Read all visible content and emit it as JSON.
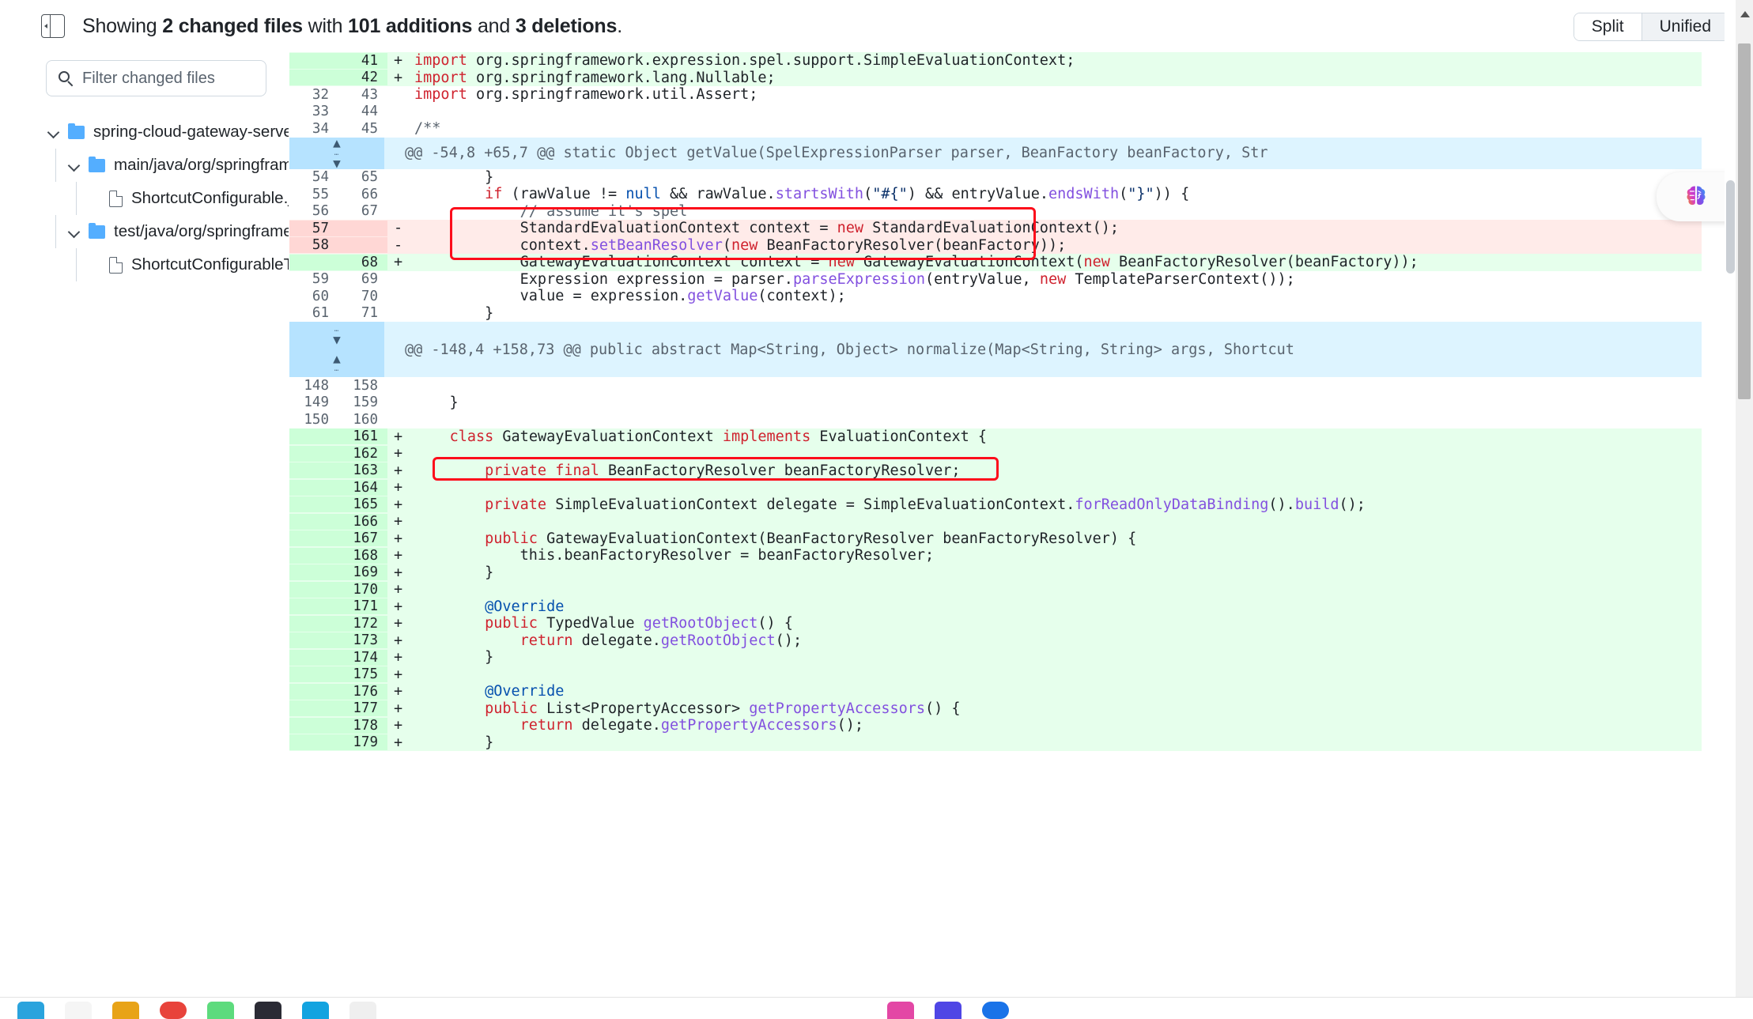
{
  "header": {
    "toggle_sidebar_icon": "sidebar-collapse-icon",
    "summary_prefix": "Showing ",
    "summary_files": "2 changed files",
    "summary_mid": " with ",
    "summary_additions": "101 additions",
    "summary_and": " and ",
    "summary_deletions": "3 deletions",
    "summary_suffix": ".",
    "view_split": "Split",
    "view_unified": "Unified",
    "active_view": "Unified"
  },
  "sidebar": {
    "filter_placeholder": "Filter changed files",
    "search_icon": "search-icon",
    "tree": [
      {
        "kind": "folder",
        "label": "spring-cloud-gateway-server/src",
        "depth": 0,
        "expanded": true
      },
      {
        "kind": "folder",
        "label": "main/java/org/springframework...",
        "depth": 1,
        "expanded": true
      },
      {
        "kind": "file",
        "label": "ShortcutConfigurable.java",
        "depth": 2,
        "status": "modified"
      },
      {
        "kind": "folder",
        "label": "test/java/org/springframework/...",
        "depth": 1,
        "expanded": true
      },
      {
        "kind": "file",
        "label": "ShortcutConfigurableTests....",
        "depth": 2,
        "status": "modified"
      }
    ]
  },
  "colors": {
    "addition_bg": "#e6ffec",
    "addition_gutter": "#ccffd8",
    "deletion_bg": "#ffebe9",
    "deletion_gutter": "#ffd7d5",
    "hunk_bg": "#ddf4ff",
    "hunk_gutter": "#b6e3ff",
    "annotation_box": "#fc0d1b",
    "folder_icon": "#54aeff",
    "status_modified": "#9a6700"
  },
  "diff": {
    "rows": [
      {
        "type": "add",
        "old": "",
        "new": "41",
        "sign": "+",
        "parts": [
          {
            "t": "import ",
            "c": "kw"
          },
          {
            "t": "org.springframework.expression.spel.support.SimpleEvaluationContext;",
            "c": ""
          }
        ]
      },
      {
        "type": "add",
        "old": "",
        "new": "42",
        "sign": "+",
        "parts": [
          {
            "t": "import ",
            "c": "kw"
          },
          {
            "t": "org.springframework.lang.Nullable;",
            "c": ""
          }
        ]
      },
      {
        "type": "ctx",
        "old": "32",
        "new": "43",
        "sign": "",
        "parts": [
          {
            "t": "import ",
            "c": "kw"
          },
          {
            "t": "org.springframework.util.Assert;",
            "c": ""
          }
        ]
      },
      {
        "type": "ctx",
        "old": "33",
        "new": "44",
        "sign": "",
        "parts": [
          {
            "t": "",
            "c": ""
          }
        ]
      },
      {
        "type": "ctx",
        "old": "34",
        "new": "45",
        "sign": "",
        "parts": [
          {
            "t": "/**",
            "c": "cmt"
          }
        ]
      },
      {
        "type": "hunk",
        "expand": "both",
        "height": 40,
        "text": "@@ -54,8 +65,7 @@ static Object getValue(SpelExpressionParser parser, BeanFactory beanFactory, Str"
      },
      {
        "type": "ctx",
        "old": "54",
        "new": "65",
        "sign": "",
        "parts": [
          {
            "t": "        }",
            "c": ""
          }
        ]
      },
      {
        "type": "ctx",
        "old": "55",
        "new": "66",
        "sign": "",
        "parts": [
          {
            "t": "        ",
            "c": ""
          },
          {
            "t": "if",
            "c": "kw"
          },
          {
            "t": " (rawValue != ",
            "c": ""
          },
          {
            "t": "null",
            "c": "num"
          },
          {
            "t": " && rawValue.",
            "c": ""
          },
          {
            "t": "startsWith",
            "c": "fn"
          },
          {
            "t": "(",
            "c": ""
          },
          {
            "t": "\"#{\"",
            "c": "str"
          },
          {
            "t": ") && entryValue.",
            "c": ""
          },
          {
            "t": "endsWith",
            "c": "fn"
          },
          {
            "t": "(",
            "c": ""
          },
          {
            "t": "\"}\"",
            "c": "str"
          },
          {
            "t": ")) {",
            "c": ""
          }
        ]
      },
      {
        "type": "ctx",
        "old": "56",
        "new": "67",
        "sign": "",
        "parts": [
          {
            "t": "            // assume it's spel",
            "c": "cmt"
          }
        ]
      },
      {
        "type": "del",
        "old": "57",
        "new": "",
        "sign": "-",
        "parts": [
          {
            "t": "            StandardEvaluationContext context = ",
            "c": ""
          },
          {
            "t": "new",
            "c": "kw"
          },
          {
            "t": " StandardEvaluationContext();",
            "c": ""
          }
        ]
      },
      {
        "type": "del",
        "old": "58",
        "new": "",
        "sign": "-",
        "parts": [
          {
            "t": "            context.",
            "c": ""
          },
          {
            "t": "setBeanResolver",
            "c": "fn"
          },
          {
            "t": "(",
            "c": ""
          },
          {
            "t": "new",
            "c": "kw"
          },
          {
            "t": " BeanFactoryResolver(beanFactory));",
            "c": ""
          }
        ]
      },
      {
        "type": "add",
        "old": "",
        "new": "68",
        "sign": "+",
        "parts": [
          {
            "t": "            GatewayEvaluationContext context = ",
            "c": ""
          },
          {
            "t": "new",
            "c": "kw"
          },
          {
            "t": " GatewayEvaluationContext(",
            "c": ""
          },
          {
            "t": "new",
            "c": "kw"
          },
          {
            "t": " BeanFactoryResolver(beanFactory));",
            "c": ""
          }
        ]
      },
      {
        "type": "ctx",
        "old": "59",
        "new": "69",
        "sign": "",
        "parts": [
          {
            "t": "            Expression expression = parser.",
            "c": ""
          },
          {
            "t": "parseExpression",
            "c": "fn"
          },
          {
            "t": "(entryValue, ",
            "c": ""
          },
          {
            "t": "new",
            "c": "kw"
          },
          {
            "t": " TemplateParserContext());",
            "c": ""
          }
        ]
      },
      {
        "type": "ctx",
        "old": "60",
        "new": "70",
        "sign": "",
        "parts": [
          {
            "t": "            value = expression.",
            "c": ""
          },
          {
            "t": "getValue",
            "c": "fn"
          },
          {
            "t": "(context);",
            "c": ""
          }
        ]
      },
      {
        "type": "ctx",
        "old": "61",
        "new": "71",
        "sign": "",
        "parts": [
          {
            "t": "        }",
            "c": ""
          }
        ]
      },
      {
        "type": "hunk",
        "expand": "updown",
        "height": 70,
        "text": "@@ -148,4 +158,73 @@ public abstract Map<String, Object> normalize(Map<String, String> args, Shortcut"
      },
      {
        "type": "ctx",
        "old": "148",
        "new": "158",
        "sign": "",
        "parts": [
          {
            "t": "",
            "c": ""
          }
        ]
      },
      {
        "type": "ctx",
        "old": "149",
        "new": "159",
        "sign": "",
        "parts": [
          {
            "t": "    }",
            "c": ""
          }
        ]
      },
      {
        "type": "ctx",
        "old": "150",
        "new": "160",
        "sign": "",
        "parts": [
          {
            "t": "",
            "c": ""
          }
        ]
      },
      {
        "type": "add",
        "old": "",
        "new": "161",
        "sign": "+",
        "parts": [
          {
            "t": "    ",
            "c": ""
          },
          {
            "t": "class",
            "c": "kw"
          },
          {
            "t": " GatewayEvaluationContext ",
            "c": ""
          },
          {
            "t": "implements",
            "c": "kw"
          },
          {
            "t": " EvaluationContext {",
            "c": ""
          }
        ]
      },
      {
        "type": "add",
        "old": "",
        "new": "162",
        "sign": "+",
        "parts": [
          {
            "t": "",
            "c": ""
          }
        ]
      },
      {
        "type": "add",
        "old": "",
        "new": "163",
        "sign": "+",
        "parts": [
          {
            "t": "        ",
            "c": ""
          },
          {
            "t": "private final",
            "c": "kw"
          },
          {
            "t": " BeanFactoryResolver beanFactoryResolver;",
            "c": ""
          }
        ]
      },
      {
        "type": "add",
        "old": "",
        "new": "164",
        "sign": "+",
        "parts": [
          {
            "t": "",
            "c": ""
          }
        ]
      },
      {
        "type": "add",
        "old": "",
        "new": "165",
        "sign": "+",
        "parts": [
          {
            "t": "        ",
            "c": ""
          },
          {
            "t": "private",
            "c": "kw"
          },
          {
            "t": " SimpleEvaluationContext delegate = SimpleEvaluationContext.",
            "c": ""
          },
          {
            "t": "forReadOnlyDataBinding",
            "c": "fn"
          },
          {
            "t": "().",
            "c": ""
          },
          {
            "t": "build",
            "c": "fn"
          },
          {
            "t": "();",
            "c": ""
          }
        ]
      },
      {
        "type": "add",
        "old": "",
        "new": "166",
        "sign": "+",
        "parts": [
          {
            "t": "",
            "c": ""
          }
        ]
      },
      {
        "type": "add",
        "old": "",
        "new": "167",
        "sign": "+",
        "parts": [
          {
            "t": "        ",
            "c": ""
          },
          {
            "t": "public",
            "c": "kw"
          },
          {
            "t": " GatewayEvaluationContext(BeanFactoryResolver beanFactoryResolver) {",
            "c": ""
          }
        ]
      },
      {
        "type": "add",
        "old": "",
        "new": "168",
        "sign": "+",
        "parts": [
          {
            "t": "            this.beanFactoryResolver = beanFactoryResolver;",
            "c": ""
          }
        ]
      },
      {
        "type": "add",
        "old": "",
        "new": "169",
        "sign": "+",
        "parts": [
          {
            "t": "        }",
            "c": ""
          }
        ]
      },
      {
        "type": "add",
        "old": "",
        "new": "170",
        "sign": "+",
        "parts": [
          {
            "t": "",
            "c": ""
          }
        ]
      },
      {
        "type": "add",
        "old": "",
        "new": "171",
        "sign": "+",
        "parts": [
          {
            "t": "        ",
            "c": ""
          },
          {
            "t": "@Override",
            "c": "ann"
          }
        ]
      },
      {
        "type": "add",
        "old": "",
        "new": "172",
        "sign": "+",
        "parts": [
          {
            "t": "        ",
            "c": ""
          },
          {
            "t": "public",
            "c": "kw"
          },
          {
            "t": " TypedValue ",
            "c": ""
          },
          {
            "t": "getRootObject",
            "c": "fn"
          },
          {
            "t": "() {",
            "c": ""
          }
        ]
      },
      {
        "type": "add",
        "old": "",
        "new": "173",
        "sign": "+",
        "parts": [
          {
            "t": "            ",
            "c": ""
          },
          {
            "t": "return",
            "c": "kw"
          },
          {
            "t": " delegate.",
            "c": ""
          },
          {
            "t": "getRootObject",
            "c": "fn"
          },
          {
            "t": "();",
            "c": ""
          }
        ]
      },
      {
        "type": "add",
        "old": "",
        "new": "174",
        "sign": "+",
        "parts": [
          {
            "t": "        }",
            "c": ""
          }
        ]
      },
      {
        "type": "add",
        "old": "",
        "new": "175",
        "sign": "+",
        "parts": [
          {
            "t": "",
            "c": ""
          }
        ]
      },
      {
        "type": "add",
        "old": "",
        "new": "176",
        "sign": "+",
        "parts": [
          {
            "t": "        ",
            "c": ""
          },
          {
            "t": "@Override",
            "c": "ann"
          }
        ]
      },
      {
        "type": "add",
        "old": "",
        "new": "177",
        "sign": "+",
        "parts": [
          {
            "t": "        ",
            "c": ""
          },
          {
            "t": "public",
            "c": "kw"
          },
          {
            "t": " List<PropertyAccessor> ",
            "c": ""
          },
          {
            "t": "getPropertyAccessors",
            "c": "fn"
          },
          {
            "t": "() {",
            "c": ""
          }
        ]
      },
      {
        "type": "add",
        "old": "",
        "new": "178",
        "sign": "+",
        "parts": [
          {
            "t": "            ",
            "c": ""
          },
          {
            "t": "return",
            "c": "kw"
          },
          {
            "t": " delegate.",
            "c": ""
          },
          {
            "t": "getPropertyAccessors",
            "c": "fn"
          },
          {
            "t": "();",
            "c": ""
          }
        ]
      },
      {
        "type": "add",
        "old": "",
        "new": "179",
        "sign": "+",
        "parts": [
          {
            "t": "        }",
            "c": ""
          }
        ]
      }
    ]
  },
  "overlay": {
    "copilot_icon": "copilot-brain-icon"
  }
}
